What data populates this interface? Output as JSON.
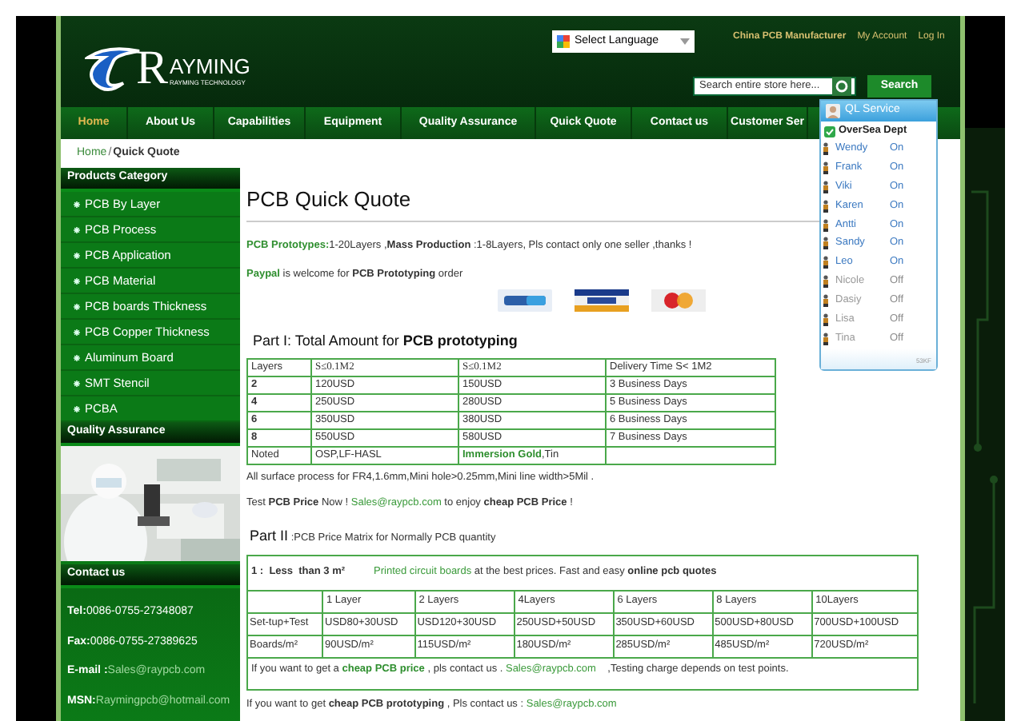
{
  "header": {
    "logo": {
      "letter": "R",
      "wordmark": "AYMING",
      "tagline": "RAYMING TECHNOLOGY"
    },
    "language_select": "Select Language",
    "top_links": [
      {
        "label": "China PCB Manufacturer",
        "kind": "highlight"
      },
      {
        "label": "My Account",
        "kind": "plain"
      },
      {
        "label": "Log In",
        "kind": "plain"
      }
    ],
    "search": {
      "placeholder": "Search entire store here...",
      "button": "Search"
    }
  },
  "nav": [
    {
      "label": "Home",
      "selected": true
    },
    {
      "label": "About Us",
      "selected": false
    },
    {
      "label": "Capabilities",
      "selected": false
    },
    {
      "label": "Equipment",
      "selected": false
    },
    {
      "label": "Quality Assurance",
      "selected": false
    },
    {
      "label": "Quick Quote",
      "selected": false
    },
    {
      "label": "Contact us",
      "selected": false
    },
    {
      "label": "Customer Ser",
      "selected": false
    }
  ],
  "breadcrumb": {
    "items": [
      "Home",
      "Quick Quote"
    ],
    "separator": "/"
  },
  "sidebar": {
    "products_title": "Products Category",
    "products": [
      "PCB By Layer",
      "PCB Process",
      "PCB Application",
      "PCB Material",
      "PCB boards Thickness",
      "PCB Copper Thickness",
      "Aluminum Board",
      "SMT Stencil",
      "PCBA"
    ],
    "quality_title": "Quality Assurance",
    "contact_title": "Contact us",
    "contact": [
      {
        "label": "Tel:",
        "value": "0086-0755-27348087",
        "kind": "text"
      },
      {
        "label": "Fax:",
        "value": "0086-0755-27389625",
        "kind": "text"
      },
      {
        "label": "E-mail :",
        "value": "Sales@raypcb.com",
        "kind": "email"
      },
      {
        "label": "MSN:",
        "value": "Raymingpcb@hotmail.com",
        "kind": "email"
      }
    ]
  },
  "main": {
    "title": "PCB Quick Quote",
    "intro": [
      [
        {
          "text": "PCB Prototypes:",
          "kind": "highlight"
        },
        {
          "text": "1-20Layers ,",
          "kind": "plain"
        },
        {
          "text": "Mass Production",
          "kind": "bold"
        },
        {
          "text": " :1-8Layers, Pls contact only one seller ,thanks !",
          "kind": "plain"
        }
      ],
      [
        {
          "text": "Paypal",
          "kind": "highlight"
        },
        {
          "text": " is welcome for ",
          "kind": "plain"
        },
        {
          "text": "PCB Prototyping",
          "kind": "bold"
        },
        {
          "text": " order",
          "kind": "plain"
        }
      ]
    ],
    "part1_heading": [
      {
        "text": "Part I:  Total Amount for ",
        "kind": "plain"
      },
      {
        "text": "PCB prototyping",
        "kind": "bold"
      }
    ],
    "table1": {
      "columns": [
        "Layers",
        "S≤0.1M2",
        "S≤0.1M2",
        "Delivery Time S< 1M2"
      ],
      "rows": [
        [
          [
            {
              "text": "2",
              "kind": "bold"
            }
          ],
          [
            {
              "text": "120USD",
              "kind": "plain"
            }
          ],
          [
            {
              "text": "150USD",
              "kind": "plain"
            }
          ],
          [
            {
              "text": "3 Business Days",
              "kind": "plain"
            }
          ]
        ],
        [
          [
            {
              "text": "4",
              "kind": "bold"
            }
          ],
          [
            {
              "text": "250USD",
              "kind": "plain"
            }
          ],
          [
            {
              "text": "280USD",
              "kind": "plain"
            }
          ],
          [
            {
              "text": "5 Business Days",
              "kind": "plain"
            }
          ]
        ],
        [
          [
            {
              "text": "6",
              "kind": "bold"
            }
          ],
          [
            {
              "text": "350USD",
              "kind": "plain"
            }
          ],
          [
            {
              "text": "380USD",
              "kind": "plain"
            }
          ],
          [
            {
              "text": "6 Business Days",
              "kind": "plain"
            }
          ]
        ],
        [
          [
            {
              "text": "8",
              "kind": "bold"
            }
          ],
          [
            {
              "text": "550USD",
              "kind": "plain"
            }
          ],
          [
            {
              "text": "580USD",
              "kind": "plain"
            }
          ],
          [
            {
              "text": "7 Business Days",
              "kind": "plain"
            }
          ]
        ],
        [
          [
            {
              "text": "Noted",
              "kind": "plain"
            }
          ],
          [
            {
              "text": "OSP,LF-HASL",
              "kind": "plain"
            }
          ],
          [
            {
              "text": "Immersion Gold",
              "kind": "highlight"
            },
            {
              "text": ",Tin",
              "kind": "plain"
            }
          ],
          []
        ]
      ]
    },
    "surface_note": "All surface process for FR4,1.6mm,Mini hole>0.25mm,Mini line width>5Mil .",
    "test_line": [
      {
        "text": "Test ",
        "kind": "plain"
      },
      {
        "text": "PCB Price",
        "kind": "bold"
      },
      {
        "text": " Now ! ",
        "kind": "plain"
      },
      {
        "text": "Sales@raypcb.com",
        "kind": "link"
      },
      {
        "text": " to enjoy ",
        "kind": "plain"
      },
      {
        "text": "cheap PCB Price",
        "kind": "bold"
      },
      {
        "text": " !",
        "kind": "plain"
      }
    ],
    "part2_heading": {
      "label": "Part II",
      "rest": ":PCB Price Matrix for Normally PCB quantity"
    },
    "table2": {
      "caption": [
        {
          "text": "1 :  Less  than 3 m²",
          "kind": "bold"
        },
        {
          "text": "Printed circuit boards",
          "kind": "link"
        },
        {
          "text": " at the best prices. Fast and easy ",
          "kind": "plain"
        },
        {
          "text": "online pcb quotes",
          "kind": "bold"
        }
      ],
      "columns": [
        "",
        "1 Layer",
        "2 Layers",
        "4Layers",
        "6 Layers",
        "8 Layers",
        "10Layers"
      ],
      "rows": [
        [
          "Set-tup+Test",
          "USD80+30USD",
          "USD120+30USD",
          "250USD+50USD",
          "350USD+60USD",
          "500USD+80USD",
          "700USD+100USD"
        ],
        [
          "Boards/m²",
          "90USD/m²",
          "115USD/m²",
          "180USD/m²",
          "285USD/m²",
          "485USD/m²",
          "720USD/m²"
        ]
      ],
      "footer": [
        {
          "text": "If you want to get a ",
          "kind": "plain"
        },
        {
          "text": "cheap PCB price",
          "kind": "highlight"
        },
        {
          "text": " , pls contact us . ",
          "kind": "plain"
        },
        {
          "text": "Sales@raypcb.com",
          "kind": "link"
        },
        {
          "text": "    ,Testing charge depends on test points.",
          "kind": "plain"
        }
      ]
    },
    "final_line": [
      {
        "text": "If you want to get ",
        "kind": "plain"
      },
      {
        "text": "cheap PCB prototyping",
        "kind": "bold"
      },
      {
        "text": " , Pls contact us : ",
        "kind": "plain"
      },
      {
        "text": "Sales@raypcb.com",
        "kind": "link"
      }
    ]
  },
  "chat": {
    "title": "QL Service",
    "group": "OverSea Dept",
    "agents": [
      {
        "name": "Wendy",
        "status": "On",
        "online": true
      },
      {
        "name": "Frank",
        "status": "On",
        "online": true
      },
      {
        "name": "Viki",
        "status": "On",
        "online": true
      },
      {
        "name": "Karen",
        "status": "On",
        "online": true
      },
      {
        "name": "Antti",
        "status": "On",
        "online": true
      },
      {
        "name": "Sandy",
        "status": "On",
        "online": true
      },
      {
        "name": "Leo",
        "status": "On",
        "online": true
      },
      {
        "name": "Nicole",
        "status": "Off",
        "online": false
      },
      {
        "name": "Dasiy",
        "status": "Off",
        "online": false
      },
      {
        "name": "Lisa",
        "status": "Off",
        "online": false
      },
      {
        "name": "Tina",
        "status": "Off",
        "online": false
      }
    ],
    "footer": "53KF"
  }
}
